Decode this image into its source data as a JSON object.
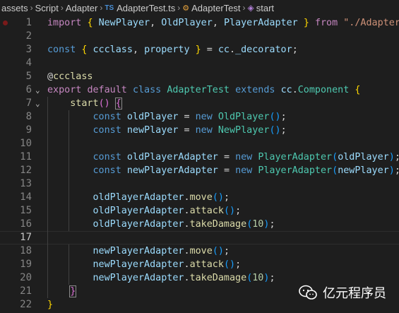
{
  "breadcrumb": {
    "items": [
      "assets",
      "Script",
      "Adapter",
      "AdapterTest.ts",
      "AdapterTest",
      "start"
    ],
    "ts_badge": "TS"
  },
  "editor": {
    "line_numbers": [
      "1",
      "2",
      "3",
      "4",
      "5",
      "6",
      "7",
      "8",
      "9",
      "10",
      "11",
      "12",
      "13",
      "14",
      "15",
      "16",
      "17",
      "18",
      "19",
      "20",
      "21",
      "22"
    ],
    "active_line": "17",
    "code": {
      "l1": [
        "import",
        "{",
        "NewPlayer",
        ",",
        "OldPlayer",
        ",",
        "PlayerAdapter",
        "}",
        "from",
        "\"./Adapter\"",
        ";"
      ],
      "l3": [
        "const",
        "{",
        "ccclass",
        ",",
        "property",
        "}",
        "=",
        "cc",
        ".",
        "_decorator",
        ";"
      ],
      "l5": [
        "@",
        "ccclass"
      ],
      "l6": [
        "export",
        "default",
        "class",
        "AdapterTest",
        "extends",
        "cc",
        ".",
        "Component",
        "{"
      ],
      "l7": [
        "start",
        "(",
        ")",
        "{"
      ],
      "l8": [
        "const",
        "oldPlayer",
        "=",
        "new",
        "OldPlayer",
        "(",
        ")",
        ";"
      ],
      "l9": [
        "const",
        "newPlayer",
        "=",
        "new",
        "NewPlayer",
        "(",
        ")",
        ";"
      ],
      "l11": [
        "const",
        "oldPlayerAdapter",
        "=",
        "new",
        "PlayerAdapter",
        "(",
        "oldPlayer",
        ")",
        ";"
      ],
      "l12": [
        "const",
        "newPlayerAdapter",
        "=",
        "new",
        "PlayerAdapter",
        "(",
        "newPlayer",
        ")",
        ";"
      ],
      "l14": [
        "oldPlayerAdapter",
        ".",
        "move",
        "(",
        ")",
        ";"
      ],
      "l15": [
        "oldPlayerAdapter",
        ".",
        "attack",
        "(",
        ")",
        ";"
      ],
      "l16": [
        "oldPlayerAdapter",
        ".",
        "takeDamage",
        "(",
        "10",
        ")",
        ";"
      ],
      "l18": [
        "newPlayerAdapter",
        ".",
        "move",
        "(",
        ")",
        ";"
      ],
      "l19": [
        "newPlayerAdapter",
        ".",
        "attack",
        "(",
        ")",
        ";"
      ],
      "l20": [
        "newPlayerAdapter",
        ".",
        "takeDamage",
        "(",
        "10",
        ")",
        ";"
      ],
      "l21": [
        "}"
      ],
      "l22": [
        "}"
      ]
    }
  },
  "watermark": {
    "text": "亿元程序员",
    "icon": "wechat-icon"
  },
  "colors": {
    "background": "#1e1e1e",
    "keyword": "#c586c0",
    "storage": "#569cd6",
    "string": "#ce9178",
    "variable": "#9cdcfe",
    "function": "#dcdcaa",
    "class": "#4ec9b0",
    "number": "#b5cea8"
  }
}
